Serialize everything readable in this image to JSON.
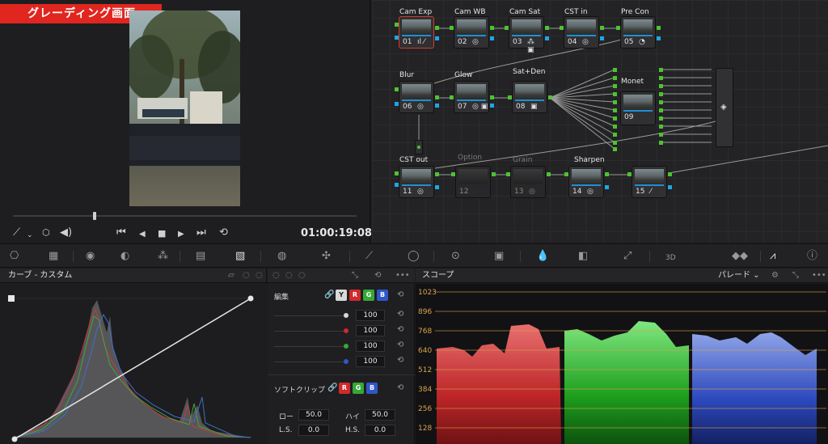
{
  "page_tag": "グレーディング画面",
  "viewer": {
    "timecode": "01:00:19:08",
    "controls": [
      "picker-icon",
      "chevron-down-icon",
      "cube-icon",
      "volume-icon",
      "skip-back-icon",
      "step-back-icon",
      "stop-icon",
      "play-icon",
      "skip-forward-icon",
      "loop-icon"
    ]
  },
  "nodes": [
    {
      "label": "Cam Exp",
      "num": "01",
      "icon": "ıl ⁄",
      "selected": true
    },
    {
      "label": "Cam WB",
      "num": "02",
      "icon": "◎"
    },
    {
      "label": "Cam Sat",
      "num": "03",
      "icon": "⁂ ▣"
    },
    {
      "label": "CST in",
      "num": "04",
      "icon": "◎"
    },
    {
      "label": "Pre Con",
      "num": "05",
      "icon": "◔"
    },
    {
      "label": "Blur",
      "num": "06",
      "icon": "◎"
    },
    {
      "label": "Glow",
      "num": "07",
      "icon": "◎ ▣"
    },
    {
      "label": "Sat+Den",
      "num": "08",
      "icon": "▣"
    },
    {
      "label": "Monet",
      "num": "09",
      "icon": ""
    },
    {
      "label": "CST out",
      "num": "11",
      "icon": "◎"
    },
    {
      "label": "Option",
      "num": "12",
      "icon": "",
      "disabled": true
    },
    {
      "label": "Grain",
      "num": "13",
      "icon": "◎",
      "disabled": true
    },
    {
      "label": "Sharpen",
      "num": "14",
      "icon": "◎"
    },
    {
      "label": "",
      "num": "15",
      "icon": "⁄"
    }
  ],
  "curves": {
    "title": "カーブ - カスタム"
  },
  "edit": {
    "title": "編集",
    "channels": [
      "Y",
      "R",
      "G",
      "B"
    ],
    "values": [
      "100",
      "100",
      "100",
      "100"
    ],
    "soft_clip_title": "ソフトクリップ",
    "soft_clip_channels": [
      "R",
      "G",
      "B"
    ],
    "low_label": "ロー",
    "low_value": "50.0",
    "high_label": "ハイ",
    "high_value": "50.0",
    "ls_label": "L.S.",
    "ls_value": "0.0",
    "hs_label": "H.S.",
    "hs_value": "0.0"
  },
  "scope": {
    "title": "スコープ",
    "mode": "パレード",
    "y_labels": [
      "1023",
      "896",
      "768",
      "640",
      "512",
      "384",
      "256",
      "128"
    ]
  },
  "colors": {
    "accent_red": "#e0261f",
    "link_blue": "#1f8fd6",
    "port_green": "#4ec232",
    "port_blue": "#1da6e8",
    "scope_grid": "#d9a34a"
  }
}
